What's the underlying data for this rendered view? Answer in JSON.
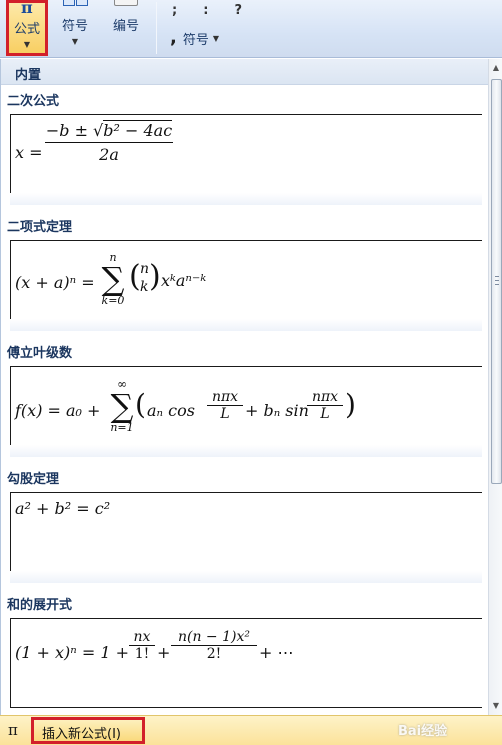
{
  "ribbon": {
    "formula_label": "公式",
    "symbol_label": "符号",
    "number_label": "编号",
    "punct": [
      ";",
      ":",
      "?"
    ],
    "symbol2_label": "符号"
  },
  "gallery": {
    "builtin_label": "内置",
    "categories": [
      "二次公式",
      "二项式定理",
      "傅立叶级数",
      "勾股定理",
      "和的展开式"
    ]
  },
  "formulas": {
    "quadratic": {
      "lhs": "x =",
      "num": "−b ± √",
      "radicand": "b² − 4ac",
      "den": "2a"
    },
    "binomial": {
      "lhs": "(x + a)ⁿ =",
      "sum_top": "n",
      "sum_bottom": "k=0",
      "binom_top": "n",
      "binom_bottom": "k",
      "tail": "xᵏaⁿ⁻ᵏ"
    },
    "fourier": {
      "lhs": "f(x) = a₀ +",
      "sum_top": "∞",
      "sum_bottom": "n=1",
      "an": "aₙ cos",
      "frac_num": "nπx",
      "frac_den": "L",
      "plus_bn": "+ bₙ sin",
      "frac2_num": "nπx",
      "frac2_den": "L"
    },
    "pythagorean": {
      "expr": "a² + b² = c²"
    },
    "expansion": {
      "lhs": "(1 + x)ⁿ = 1 +",
      "f1_num": "nx",
      "f1_den": "1!",
      "plus": "+",
      "f2_num": "n(n − 1)x²",
      "f2_den": "2!",
      "tail": "+ ⋯"
    }
  },
  "footer": {
    "pi_icon": "π",
    "insert_label": "插入新公式(I)",
    "watermark": "Bai经验"
  },
  "colors": {
    "highlight_border": "#d2202a",
    "ribbon_bg": "#d6e3f5",
    "footer_bg": "#fbe29a"
  }
}
